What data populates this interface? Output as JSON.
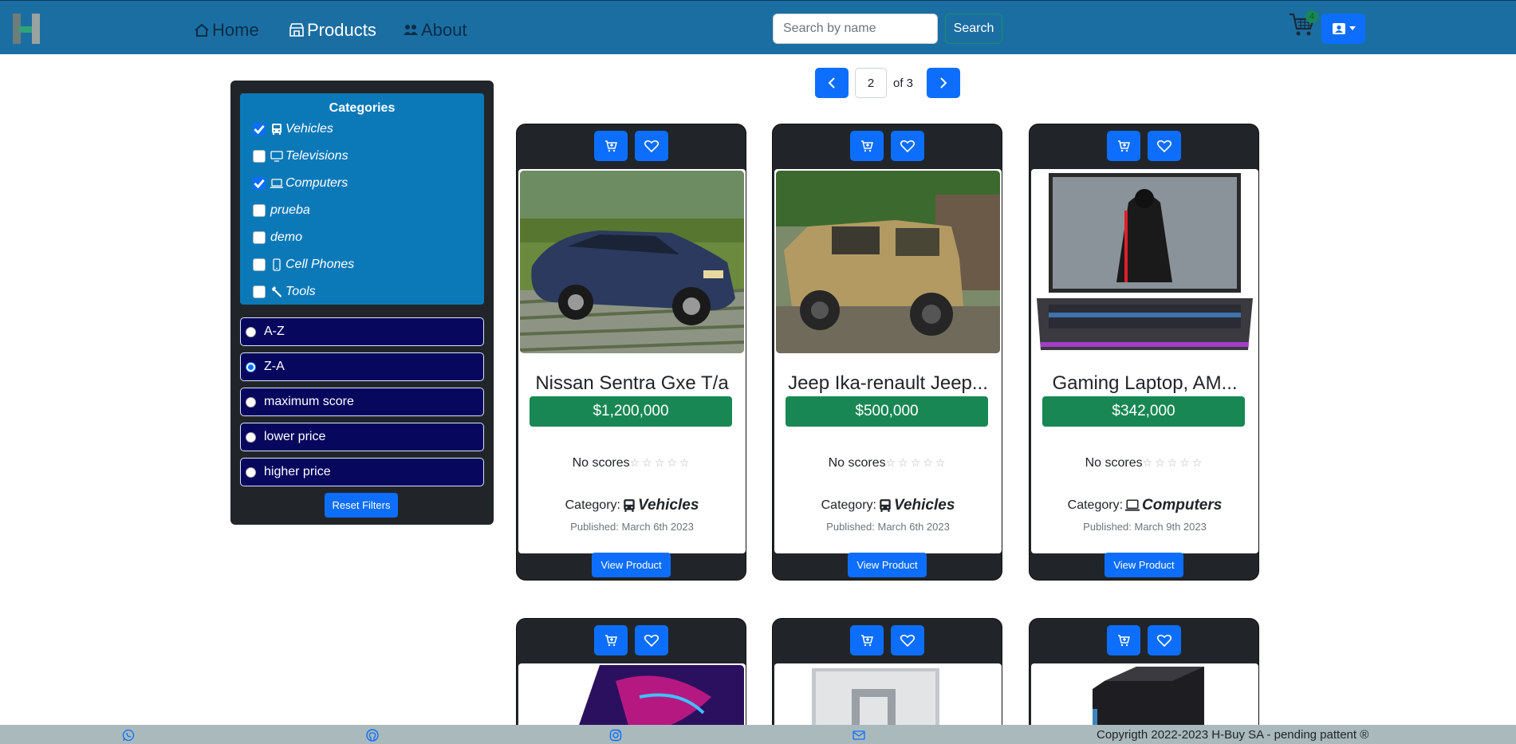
{
  "nav": {
    "home": "Home",
    "products": "Products",
    "about": "About",
    "search_placeholder": "Search by name",
    "search_label": "Search",
    "cart_count": "4"
  },
  "sidebar": {
    "categories_title": "Categories",
    "categories": [
      {
        "label": "Vehicles",
        "checked": true,
        "icon": "bus-icon"
      },
      {
        "label": "Televisions",
        "checked": false,
        "icon": "tv-icon"
      },
      {
        "label": "Computers",
        "checked": true,
        "icon": "laptop-icon"
      },
      {
        "label": "prueba",
        "checked": false,
        "icon": ""
      },
      {
        "label": "demo",
        "checked": false,
        "icon": ""
      },
      {
        "label": "Cell Phones",
        "checked": false,
        "icon": "phone-icon"
      },
      {
        "label": "Tools",
        "checked": false,
        "icon": "wrench-icon"
      }
    ],
    "sort_options": [
      {
        "label": "A-Z",
        "selected": false
      },
      {
        "label": "Z-A",
        "selected": true
      },
      {
        "label": "maximum score",
        "selected": false
      },
      {
        "label": "lower price",
        "selected": false
      },
      {
        "label": "higher price",
        "selected": false
      }
    ],
    "reset_label": "Reset Filters"
  },
  "pagination": {
    "current": "2",
    "of_text": "of 3"
  },
  "products": [
    {
      "name": "Nissan Sentra Gxe T/a",
      "price": "$1,200,000",
      "scores": "No scores",
      "category_label": "Category:",
      "category": "Vehicles",
      "published": "Published: March 6th 2023",
      "view_label": "View Product"
    },
    {
      "name": "Jeep Ika-renault Jeep...",
      "price": "$500,000",
      "scores": "No scores",
      "category_label": "Category:",
      "category": "Vehicles",
      "published": "Published: March 6th 2023",
      "view_label": "View Product"
    },
    {
      "name": "Gaming Laptop, AM...",
      "price": "$342,000",
      "scores": "No scores",
      "category_label": "Category:",
      "category": "Computers",
      "published": "Published: March 9th 2023",
      "view_label": "View Product"
    }
  ],
  "footer": {
    "copyright": "Copyrigth 2022-2023 H-Buy SA - pending pattent ®"
  },
  "colors": {
    "navbar": "#1b6ea2",
    "primary": "#0d6efd",
    "price": "#198754",
    "sidebar": "#212529",
    "category_box": "#0b79b8",
    "sort_option": "#07075e",
    "footer": "#a9b9bc"
  }
}
